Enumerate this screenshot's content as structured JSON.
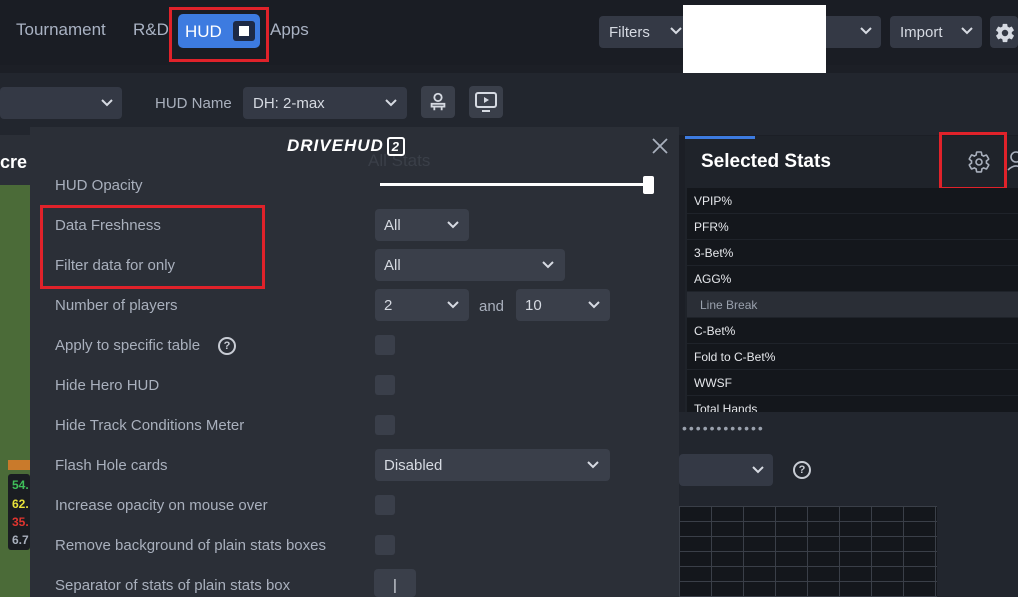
{
  "topbar": {
    "nav": [
      "Tournament",
      "R&D",
      "HUD",
      "Apps"
    ],
    "filters_label": "Filters",
    "import_label": "Import"
  },
  "toolbar": {
    "hud_name_label": "HUD Name",
    "hud_name_value": "DH: 2-max"
  },
  "background": {
    "left_header_text": "cre",
    "ghost_all_stats": "All Stats",
    "stats_numbers": [
      "54.",
      "62.",
      "35.",
      "6.7"
    ],
    "stats_colors": [
      "#3fbf5a",
      "#e8e23a",
      "#e0352f",
      "#a9b0bd"
    ]
  },
  "modal": {
    "logo_text": "DRIVEHUD",
    "logo_badge": "2",
    "settings": [
      {
        "label": "HUD Opacity",
        "control": "slider",
        "value": 1.0
      },
      {
        "label": "Data Freshness",
        "control": "select",
        "value": "All"
      },
      {
        "label": "Filter data for only",
        "control": "select",
        "value": "All"
      },
      {
        "label": "Number of players",
        "control": "range",
        "min": "2",
        "max": "10",
        "joiner": "and"
      },
      {
        "label": "Apply to specific table",
        "control": "checkbox"
      },
      {
        "label": "Hide Hero HUD",
        "control": "checkbox"
      },
      {
        "label": "Hide Track Conditions Meter",
        "control": "checkbox"
      },
      {
        "label": "Flash Hole cards",
        "control": "select",
        "value": "Disabled"
      },
      {
        "label": "Increase opacity on mouse over",
        "control": "checkbox"
      },
      {
        "label": "Remove background of plain stats boxes",
        "control": "checkbox"
      },
      {
        "label": "Separator of stats of plain stats box",
        "control": "text",
        "value": "|"
      }
    ]
  },
  "selected_stats": {
    "title": "Selected Stats",
    "items": [
      "VPIP%",
      "PFR%",
      "3-Bet%",
      "AGG%",
      "Line Break",
      "C-Bet%",
      "Fold to C-Bet%",
      "WWSF",
      "Total Hands"
    ]
  },
  "colors": {
    "accent": "#3d7be0",
    "highlight_box": "#e0222a"
  }
}
